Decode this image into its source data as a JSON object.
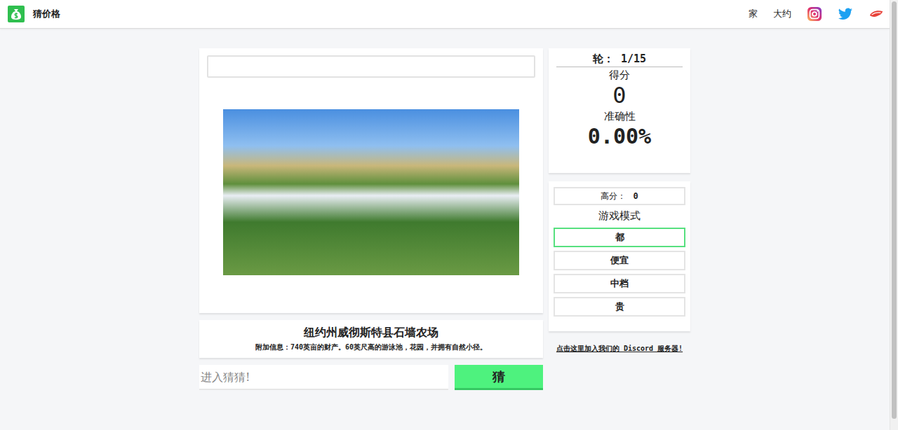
{
  "nav": {
    "title": "猜价格",
    "links": [
      "家",
      "大约"
    ]
  },
  "top_field": {
    "value": ""
  },
  "listing": {
    "title": "纽约州威彻斯特县石墙农场",
    "info": "附加信息：740英亩的财产。60英尺高的游泳池，花园，并拥有自然小径。"
  },
  "guess": {
    "placeholder": "进入猜猜!",
    "button": "猜"
  },
  "stats": {
    "round_label": "轮：",
    "round": "1/15",
    "score_label": "得分",
    "score": "0",
    "accuracy_label": "准确性",
    "accuracy": "0.00%"
  },
  "high_score": {
    "label": "高分：",
    "value": "0"
  },
  "modes": {
    "title": "游戏模式",
    "items": [
      {
        "label": "都",
        "selected": true
      },
      {
        "label": "便宜",
        "selected": false
      },
      {
        "label": "中档",
        "selected": false
      },
      {
        "label": "贵",
        "selected": false
      }
    ]
  },
  "discord": "点击这里加入我们的 Discord 服务器!"
}
